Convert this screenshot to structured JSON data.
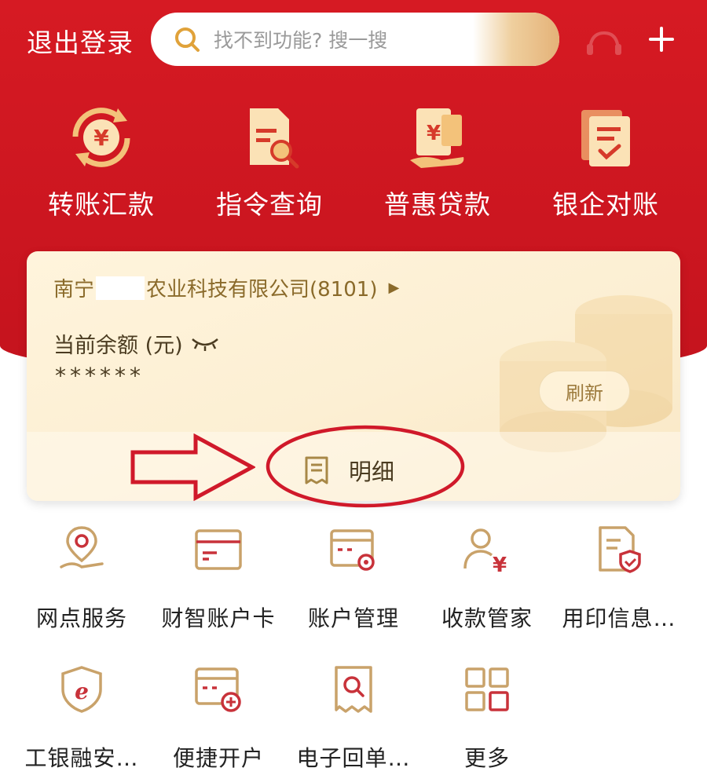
{
  "header": {
    "logout_label": "退出登录",
    "search_placeholder": "找不到功能? 搜一搜"
  },
  "quick_menu": [
    {
      "label": "转账汇款",
      "icon": "yuan-exchange-icon"
    },
    {
      "label": "指令查询",
      "icon": "document-search-icon"
    },
    {
      "label": "普惠贷款",
      "icon": "loan-hand-icon"
    },
    {
      "label": "银企对账",
      "icon": "reconcile-check-icon"
    }
  ],
  "account": {
    "company_prefix": "南宁",
    "company_suffix": "农业科技有限公司(8101)",
    "balance_label": "当前余额 (元)",
    "balance_value": "******",
    "refresh_label": "刷新",
    "detail_label": "明细"
  },
  "services": [
    {
      "label": "网点服务",
      "icon": "location-hand-icon"
    },
    {
      "label": "财智账户卡",
      "icon": "bank-card-icon"
    },
    {
      "label": "账户管理",
      "icon": "card-settings-icon"
    },
    {
      "label": "收款管家",
      "icon": "person-yuan-icon"
    },
    {
      "label": "用印信息…",
      "icon": "document-shield-icon"
    },
    {
      "label": "工银融安…",
      "icon": "e-shield-icon"
    },
    {
      "label": "便捷开户",
      "icon": "card-add-icon"
    },
    {
      "label": "电子回单…",
      "icon": "receipt-search-icon"
    },
    {
      "label": "更多",
      "icon": "more-grid-icon"
    }
  ],
  "colors": {
    "brand_red": "#d61a23",
    "icon_red": "#c8323a",
    "icon_gold": "#c9a26a",
    "annotation_red": "#d0192a"
  }
}
